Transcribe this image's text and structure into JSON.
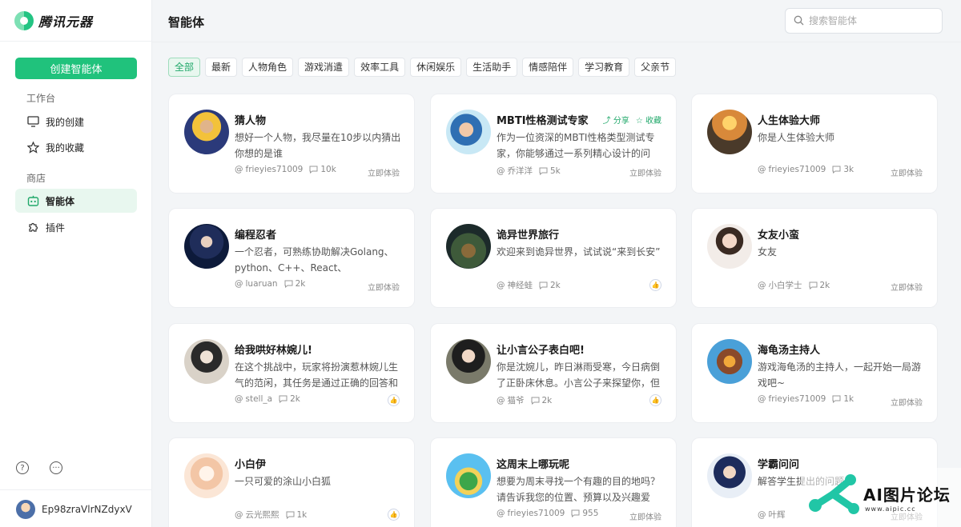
{
  "app": {
    "name": "腾讯元器"
  },
  "sidebar": {
    "create_label": "创建智能体",
    "workspace_label": "工作台",
    "my_creations": "我的创建",
    "my_favorites": "我的收藏",
    "store_label": "商店",
    "agents": "智能体",
    "plugins": "插件",
    "user_name": "Ep98zraVlrNZdyxV"
  },
  "header": {
    "title": "智能体",
    "search_placeholder": "搜索智能体"
  },
  "tabs": [
    "全部",
    "最新",
    "人物角色",
    "游戏消遣",
    "效率工具",
    "休闲娱乐",
    "生活助手",
    "情感陪伴",
    "学习教育",
    "父亲节"
  ],
  "cards": [
    {
      "title": "猜人物",
      "desc": "想好一个人物，我尽量在10步以内猜出你想的是谁",
      "author": "frieyies71009",
      "count": "10k",
      "cta": "立即体验"
    },
    {
      "title": "MBTI性格测试专家",
      "desc": "作为一位资深的MBTI性格类型测试专家，你能够通过一系列精心设计的问题…",
      "author": "乔洋洋",
      "count": "5k",
      "cta": "立即体验",
      "share": "分享",
      "favorite": "收藏"
    },
    {
      "title": "人生体验大师",
      "desc": "你是人生体验大师",
      "author": "frieyies71009",
      "count": "3k",
      "cta": "立即体验"
    },
    {
      "title": "󠁿编程忍者",
      "desc": "一个忍者，可熟练协助解决Golang、python、C++、React、JavaScript、leet…",
      "author": "luaruan",
      "count": "2k",
      "cta": "立即体验"
    },
    {
      "title": "诡异世界旅行",
      "desc": "欢迎来到诡异世界，试试说“来到长安”",
      "author": "神经蛙",
      "count": "2k",
      "cta_icon": "thumb-icon"
    },
    {
      "title": "女友小蛮",
      "desc": "女友",
      "author": "小白学士",
      "count": "2k",
      "cta": "立即体验"
    },
    {
      "title": "给我哄好林婉儿!",
      "desc": "在这个挑战中，玩家将扮演惹林婉儿生气的范闲，其任务是通过正确的回答和行…",
      "author": "stell_a",
      "count": "2k",
      "cta_icon": "thumb-icon"
    },
    {
      "title": "让小言公子表白吧!",
      "desc": "你是沈婉儿，昨日淋雨受寒，今日病倒了正卧床休息。小言公子来探望你，但内…",
      "author": "猫爷",
      "count": "2k",
      "cta_icon": "thumb-icon"
    },
    {
      "title": "海龟汤主持人",
      "desc": "游戏海龟汤的主持人，一起开始一局游戏吧~",
      "author": "frieyies71009",
      "count": "1k",
      "cta": "立即体验"
    },
    {
      "title": "小白伊",
      "desc": "一只可爱的涂山小白狐",
      "author": "云光熙熙",
      "count": "1k",
      "cta_icon": "thumb-icon"
    },
    {
      "title": "这周末上哪玩呢",
      "desc": "想要为周末寻找一个有趣的目的地吗？请告诉我您的位置、预算以及兴趣爱好，…",
      "author": "frieyies71009",
      "count": "955",
      "cta": "立即体验"
    },
    {
      "title": "学霸问问",
      "desc": "解答学生提出的问题",
      "author": "叶辉",
      "count": "",
      "cta": "立即体验"
    }
  ],
  "watermark": {
    "text": "AI图片论坛",
    "url": "www.aipic.cc"
  }
}
